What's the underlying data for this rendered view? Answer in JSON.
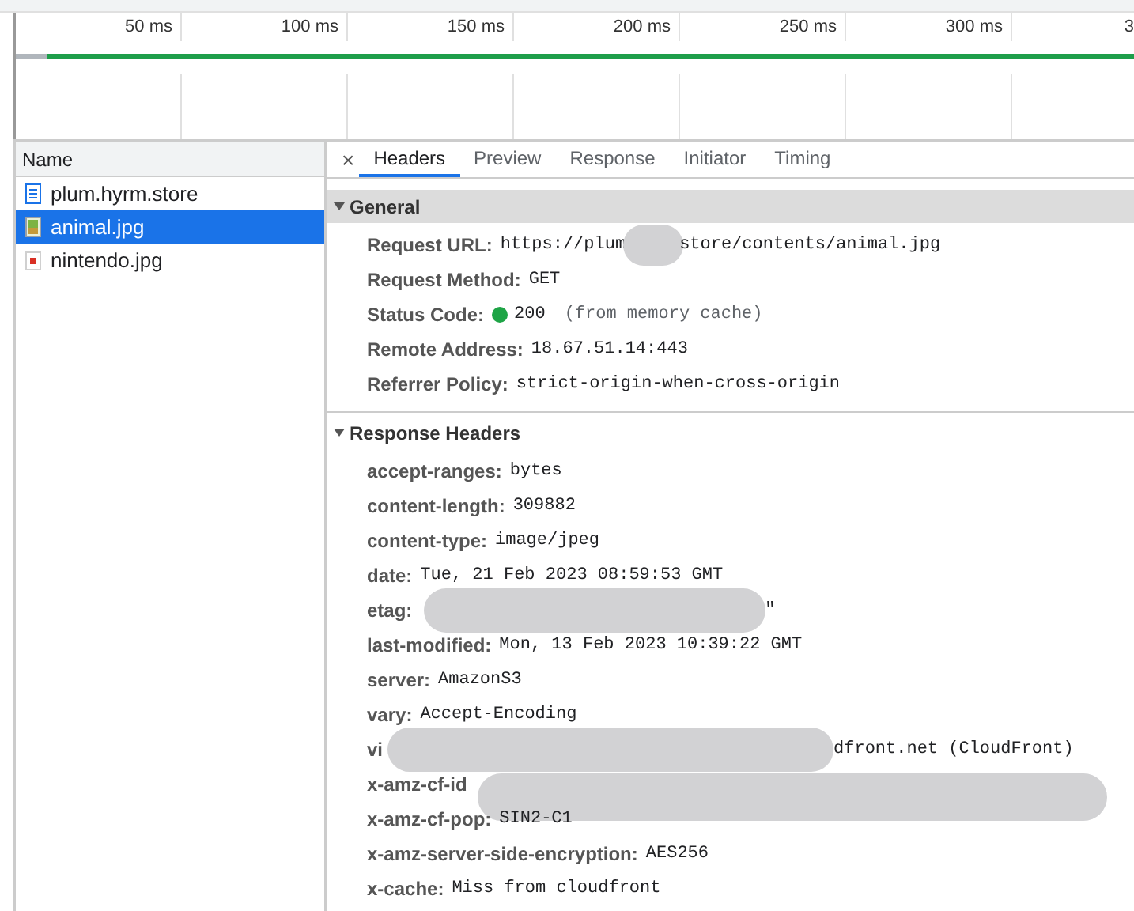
{
  "timeline": {
    "ticks": [
      "50 ms",
      "100 ms",
      "150 ms",
      "200 ms",
      "250 ms",
      "300 ms",
      "3"
    ]
  },
  "requests": {
    "header": "Name",
    "items": [
      {
        "name": "plum.hyrm.store",
        "kind": "document",
        "selected": false
      },
      {
        "name": "animal.jpg",
        "kind": "image",
        "selected": true
      },
      {
        "name": "nintendo.jpg",
        "kind": "broken-image",
        "selected": false
      }
    ]
  },
  "tabs": {
    "close": "×",
    "items": [
      {
        "label": "Headers",
        "selected": true
      },
      {
        "label": "Preview",
        "selected": false
      },
      {
        "label": "Response",
        "selected": false
      },
      {
        "label": "Initiator",
        "selected": false
      },
      {
        "label": "Timing",
        "selected": false
      }
    ]
  },
  "sections": [
    {
      "title": "General",
      "expanded": true,
      "shaded": true,
      "rows": [
        {
          "key": "Request URL:",
          "value": "https://plum",
          "redacted": true,
          "value_after": "store/contents/animal.jpg"
        },
        {
          "key": "Request Method:",
          "value": "GET"
        },
        {
          "key": "Status Code:",
          "kind": "status",
          "value": "200",
          "note": "(from memory cache)"
        },
        {
          "key": "Remote Address:",
          "value": "18.67.51.14:443"
        },
        {
          "key": "Referrer Policy:",
          "value": "strict-origin-when-cross-origin"
        }
      ]
    },
    {
      "title": "Response Headers",
      "expanded": true,
      "shaded": false,
      "rows": [
        {
          "key": "accept-ranges:",
          "value": "bytes"
        },
        {
          "key": "content-length:",
          "value": "309882"
        },
        {
          "key": "content-type:",
          "value": "image/jpeg"
        },
        {
          "key": "date:",
          "value": "Tue, 21 Feb 2023 08:59:53 GMT"
        },
        {
          "key": "etag:",
          "redacted": true,
          "value_after": "\""
        },
        {
          "key": "last-modified:",
          "value": "Mon, 13 Feb 2023 10:39:22 GMT"
        },
        {
          "key": "server:",
          "value": "AmazonS3"
        },
        {
          "key": "vary:",
          "value": "Accept-Encoding"
        },
        {
          "key": "vi",
          "redacted": true,
          "value_after": "dfront.net (CloudFront)"
        },
        {
          "key": "x-amz-cf-id",
          "redacted": true
        },
        {
          "key": "x-amz-cf-pop:",
          "value": "SIN2-C1"
        },
        {
          "key": "x-amz-server-side-encryption:",
          "value": "AES256"
        },
        {
          "key": "x-cache:",
          "value": "Miss from cloudfront"
        }
      ]
    }
  ]
}
